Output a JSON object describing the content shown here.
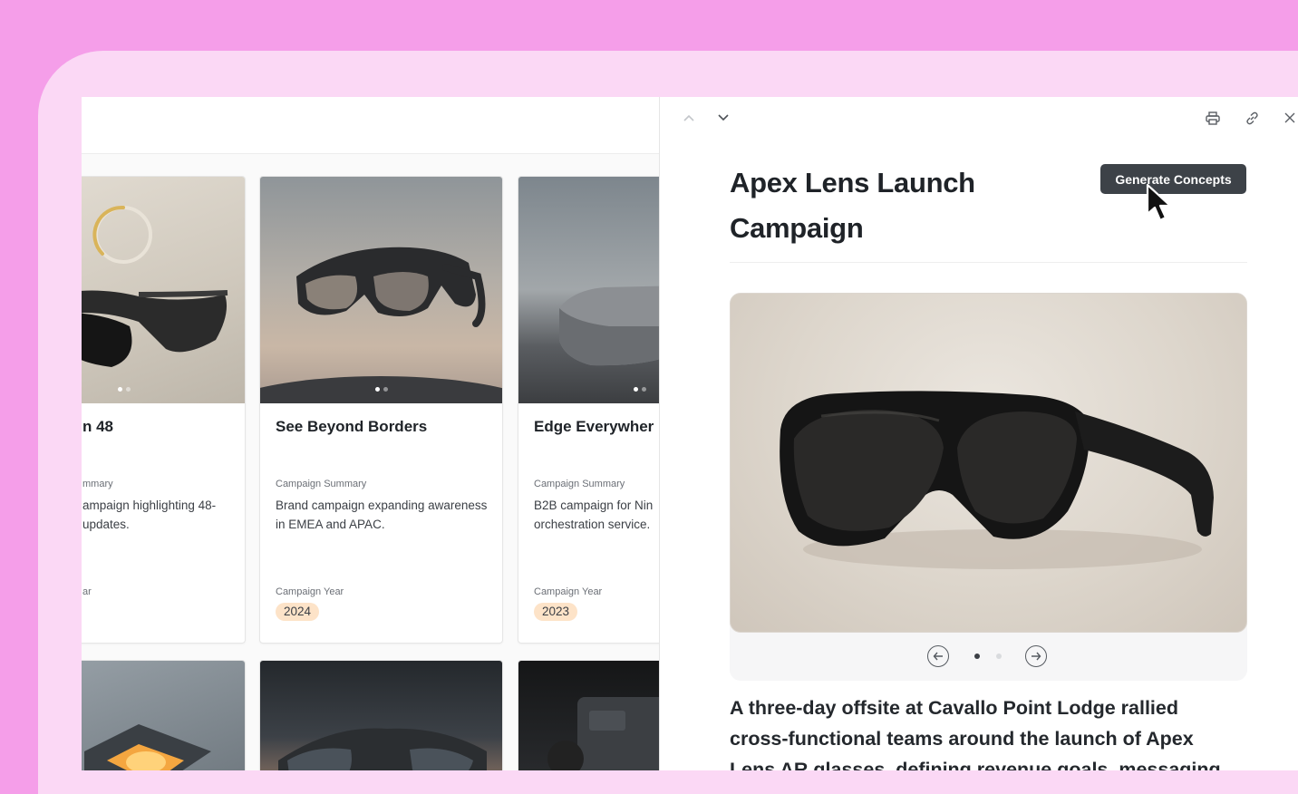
{
  "cards": [
    {
      "title": "n 48",
      "summary_label": "mmary",
      "summary": "ampaign highlighting 48-\n updates.",
      "year_label": "ar",
      "year": ""
    },
    {
      "title": "See Beyond Borders",
      "summary_label": "Campaign Summary",
      "summary": "Brand campaign expanding awareness in EMEA and APAC.",
      "year_label": "Campaign Year",
      "year": "2024"
    },
    {
      "title": "Edge Everywher",
      "summary_label": "Campaign Summary",
      "summary": "B2B campaign for Nin orchestration service.",
      "year_label": "Campaign Year",
      "year": "2023"
    }
  ],
  "detail": {
    "title": "Apex Lens Launch Campaign",
    "generate_button": "Generate Concepts",
    "description": "A three-day offsite at Cavallo Point Lodge rallied cross-functional teams around the launch of Apex Lens AR glasses, defining revenue goals, messaging",
    "carousel": {
      "slide_count": 2,
      "active_slide": 1
    },
    "icons": [
      "chevron-up-icon",
      "chevron-down-icon",
      "printer-icon",
      "link-icon",
      "close-icon",
      "arrow-left-icon",
      "arrow-right-icon"
    ]
  },
  "colors": {
    "background": "#f59ee9",
    "frame": "#fbd8f5",
    "button": "#3d4248",
    "year_badge": "#fde3c8"
  }
}
